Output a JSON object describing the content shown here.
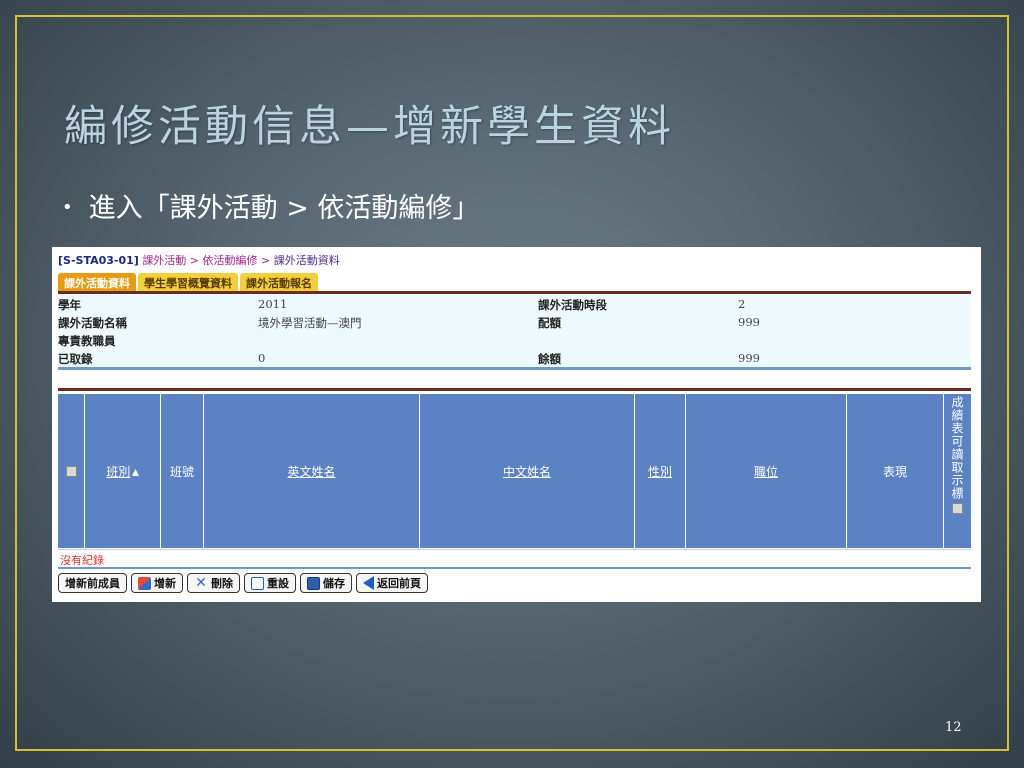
{
  "slide": {
    "title": "編修活動信息—增新學生資料",
    "bullet": "進入「課外活動 > 依活動編修」",
    "bullet_marker": "•",
    "page_number": "12"
  },
  "screen": {
    "breadcrumb": {
      "code": "[S-STA03-01]",
      "path": "課外活動 > 依活動編修 >",
      "current": "課外活動資料"
    },
    "tabs": [
      {
        "label": "課外活動資料",
        "active": true
      },
      {
        "label": "學生學習概覽資料",
        "active": false
      },
      {
        "label": "課外活動報名",
        "active": false
      }
    ],
    "info": {
      "school_year_label": "學年",
      "school_year_value": "2011",
      "period_label": "課外活動時段",
      "period_value": "2",
      "name_label": "課外活動名稱",
      "name_value": "境外學習活動—澳門",
      "quota_label": "配額",
      "quota_value": "999",
      "staff_label": "專責教職員",
      "staff_value": "",
      "admitted_label": "已取錄",
      "admitted_value": "0",
      "remaining_label": "餘額",
      "remaining_value": "999"
    },
    "table": {
      "columns": [
        {
          "label": "",
          "type": "checkbox"
        },
        {
          "label": "班別",
          "sort": "▲",
          "link": true
        },
        {
          "label": "班號",
          "link": false
        },
        {
          "label": "英文姓名",
          "link": true
        },
        {
          "label": "中文姓名",
          "link": true
        },
        {
          "label": "性別",
          "link": true
        },
        {
          "label": "職位",
          "link": true
        },
        {
          "label": "表現",
          "link": false
        },
        {
          "label": "成績表可讀取示標",
          "type": "vertical-checkbox"
        }
      ],
      "empty_message": "沒有紀錄"
    },
    "buttons": [
      {
        "label": "增新前成員",
        "icon": "none"
      },
      {
        "label": "增新",
        "icon": "add-icon"
      },
      {
        "label": "刪除",
        "icon": "delete-icon"
      },
      {
        "label": "重設",
        "icon": "reset-icon"
      },
      {
        "label": "儲存",
        "icon": "save-icon"
      },
      {
        "label": "返回前頁",
        "icon": "back-arrow-icon"
      }
    ]
  },
  "colors": {
    "frame": "#d6c230",
    "title": "#b9d3e0",
    "header": "#5b83c3",
    "tab_active": "#e59b14",
    "tab_inactive": "#f3cf3d"
  }
}
